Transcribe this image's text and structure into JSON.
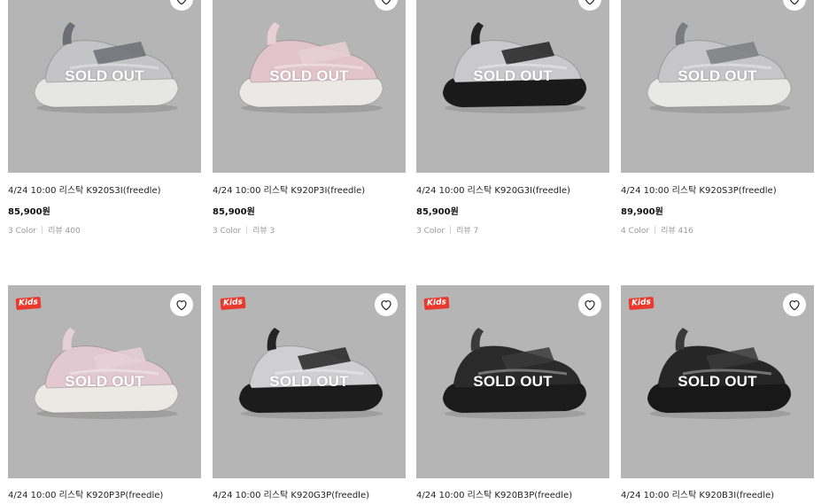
{
  "sold_out_label": "SOLD OUT",
  "kids_badge": "Kids",
  "products": [
    {
      "title": "4/24 10:00 리스탁 K920S3I(freedle)",
      "price": "85,900원",
      "colors": "3 Color",
      "reviews": "리뷰 400",
      "shoe_color": "#c4c4c6",
      "sole_color": "#e6e6e4",
      "strap_color": "#6b6e74"
    },
    {
      "title": "4/24 10:00 리스탁 K920P3I(freedle)",
      "price": "85,900원",
      "colors": "3 Color",
      "reviews": "리뷰 3",
      "shoe_color": "#e2c4cc",
      "sole_color": "#ece8e6",
      "strap_color": "#e8d0d6"
    },
    {
      "title": "4/24 10:00 리스탁 K920G3I(freedle)",
      "price": "85,900원",
      "colors": "3 Color",
      "reviews": "리뷰 7",
      "shoe_color": "#c9c9cb",
      "sole_color": "#1a1a1a",
      "strap_color": "#222222"
    },
    {
      "title": "4/24 10:00 리스탁 K920S3P(freedle)",
      "price": "89,900원",
      "colors": "4 Color",
      "reviews": "리뷰 416",
      "shoe_color": "#c6c6c8",
      "sole_color": "#e8e8e6",
      "strap_color": "#7a7c80"
    },
    {
      "title": "4/24 10:00 리스탁 K920P3P(freedle)",
      "shoe_color": "#e2c8d0",
      "sole_color": "#ece8e4",
      "strap_color": "#e6d0d8"
    },
    {
      "title": "4/24 10:00 리스탁 K920G3P(freedle)",
      "shoe_color": "#cfcfd2",
      "sole_color": "#1c1c1c",
      "strap_color": "#242424"
    },
    {
      "title": "4/24 10:00 리스탁 K920B3P(freedle)",
      "shoe_color": "#2a2a2a",
      "sole_color": "#1b1b1b",
      "strap_color": "#3a3a3a"
    },
    {
      "title": "4/24 10:00 리스탁 K920B3I(freedle)",
      "shoe_color": "#262626",
      "sole_color": "#181818",
      "strap_color": "#3a3a3a"
    }
  ]
}
